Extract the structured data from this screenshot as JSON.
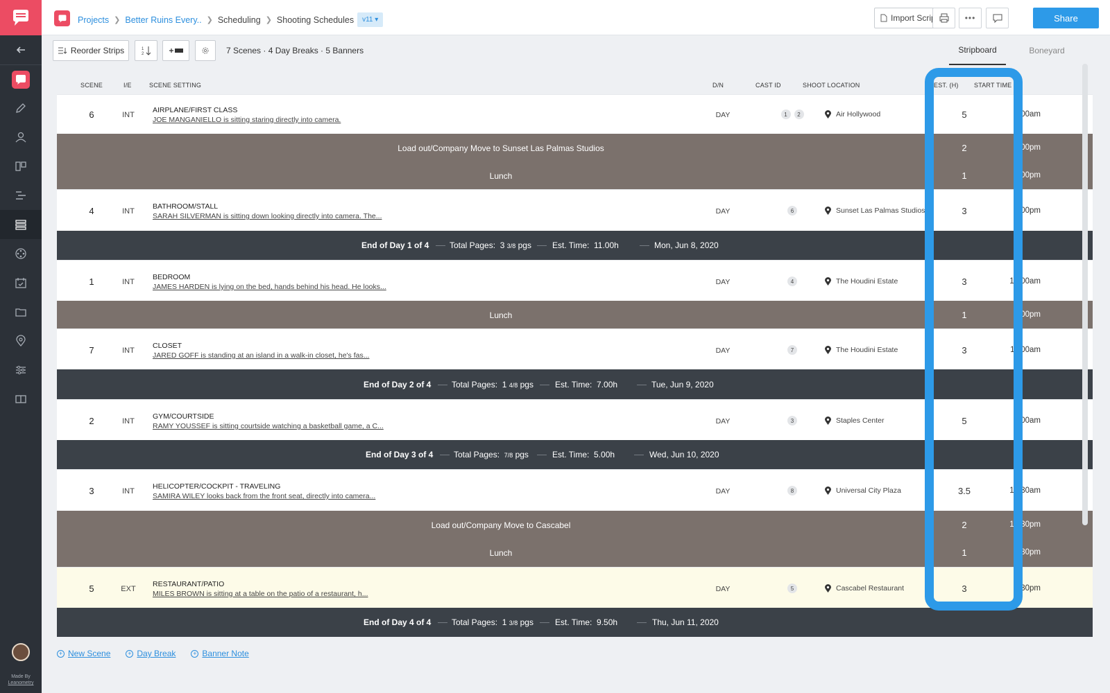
{
  "breadcrumb": {
    "projects": "Projects",
    "project": "Better Ruins Every..",
    "section": "Scheduling",
    "page": "Shooting Schedules",
    "version": "v11"
  },
  "topbar": {
    "import_label": "Import Script",
    "share_label": "Share"
  },
  "toolbar": {
    "reorder_label": "Reorder Strips",
    "sort_label": "1 2",
    "summary": "7 Scenes · 4 Day Breaks · 5 Banners",
    "tabs": [
      "Stripboard",
      "Boneyard"
    ]
  },
  "columns": {
    "scene": "SCENE",
    "ie": "I/E",
    "setting": "SCENE SETTING",
    "dn": "D/N",
    "cast": "CAST ID",
    "location": "SHOOT LOCATION",
    "est": "EST. (H)",
    "start": "START TIME"
  },
  "strips": [
    {
      "type": "scene",
      "num": "6",
      "ie": "INT",
      "setting": "AIRPLANE/FIRST CLASS",
      "desc": "JOE MANGANIELLO is sitting staring directly into camera.",
      "dn": "DAY",
      "cast": [
        "1",
        "2"
      ],
      "location": "Air Hollywood",
      "est": "5",
      "start": "8:00am"
    },
    {
      "type": "banner",
      "text": "Load out/Company Move to Sunset Las Palmas Studios",
      "est": "2",
      "start": "1:00pm"
    },
    {
      "type": "banner",
      "text": "Lunch",
      "est": "1",
      "start": "3:00pm"
    },
    {
      "type": "scene",
      "num": "4",
      "ie": "INT",
      "setting": "BATHROOM/STALL",
      "desc": "SARAH SILVERMAN is sitting down looking directly into camera. The...",
      "dn": "DAY",
      "cast": [
        "6"
      ],
      "location": "Sunset Las Palmas Studios",
      "est": "3",
      "start": "5:00pm"
    },
    {
      "type": "daybreak",
      "day": "End of Day 1 of 4",
      "pages_label": "Total Pages:",
      "pages_whole": "3",
      "pages_frac": "3/8",
      "pages_unit": "pgs",
      "time_label": "Est. Time:",
      "time": "11.00h",
      "date": "Mon, Jun 8, 2020"
    },
    {
      "type": "scene",
      "num": "1",
      "ie": "INT",
      "setting": "BEDROOM",
      "desc": "JAMES HARDEN is lying on the bed, hands behind his head. He looks...",
      "dn": "DAY",
      "cast": [
        "4"
      ],
      "location": "The Houdini Estate",
      "est": "3",
      "start": "10:00am"
    },
    {
      "type": "banner",
      "text": "Lunch",
      "est": "1",
      "start": "1:00pm"
    },
    {
      "type": "scene",
      "num": "7",
      "ie": "INT",
      "setting": "CLOSET",
      "desc": "JARED GOFF is standing at an island in a walk-in closet, he's fas...",
      "dn": "DAY",
      "cast": [
        "7"
      ],
      "location": "The Houdini Estate",
      "est": "3",
      "start": "11:00am"
    },
    {
      "type": "daybreak",
      "day": "End of Day 2 of 4",
      "pages_label": "Total Pages:",
      "pages_whole": "1",
      "pages_frac": "4/8",
      "pages_unit": "pgs",
      "time_label": "Est. Time:",
      "time": "7.00h",
      "date": "Tue, Jun 9, 2020"
    },
    {
      "type": "scene",
      "num": "2",
      "ie": "INT",
      "setting": "GYM/COURTSIDE",
      "desc": "RAMY YOUSSEF is sitting courtside watching a basketball game, a C...",
      "dn": "DAY",
      "cast": [
        "3"
      ],
      "location": "Staples Center",
      "est": "5",
      "start": "9:00am"
    },
    {
      "type": "daybreak",
      "day": "End of Day 3 of 4",
      "pages_label": "Total Pages:",
      "pages_whole": "",
      "pages_frac": "7/8",
      "pages_unit": "pgs",
      "time_label": "Est. Time:",
      "time": "5.00h",
      "date": "Wed, Jun 10, 2020"
    },
    {
      "type": "scene",
      "num": "3",
      "ie": "INT",
      "setting": "HELICOPTER/COCKPIT - TRAVELING",
      "desc": "SAMIRA WILEY looks back from the front seat, directly into camera...",
      "dn": "DAY",
      "cast": [
        "8"
      ],
      "location": "Universal City Plaza",
      "est": "3.5",
      "start": "10:30am"
    },
    {
      "type": "banner",
      "text": "Load out/Company Move to Cascabel",
      "est": "2",
      "start": "12:30pm"
    },
    {
      "type": "banner",
      "text": "Lunch",
      "est": "1",
      "start": "2:30pm"
    },
    {
      "type": "scene",
      "num": "5",
      "ie": "EXT",
      "setting": "RESTAURANT/PATIO",
      "desc": "MILES BROWN is sitting at a table on the patio of a restaurant, h...",
      "dn": "DAY",
      "cast": [
        "5"
      ],
      "location": "Cascabel Restaurant",
      "est": "3",
      "start": "3:30pm"
    },
    {
      "type": "daybreak",
      "day": "End of Day 4 of 4",
      "pages_label": "Total Pages:",
      "pages_whole": "1",
      "pages_frac": "3/8",
      "pages_unit": "pgs",
      "time_label": "Est. Time:",
      "time": "9.50h",
      "date": "Thu, Jun 11, 2020"
    }
  ],
  "footer": {
    "new_scene": "New Scene",
    "day_break": "Day Break",
    "banner_note": "Banner Note"
  },
  "rail": {
    "made_by_line1": "Made By",
    "made_by_line2": "Leanometry"
  },
  "colors": {
    "accent": "#2d9ae8",
    "brand": "#ec4c63",
    "banner": "#7b716c",
    "daybreak": "#3b4148"
  }
}
